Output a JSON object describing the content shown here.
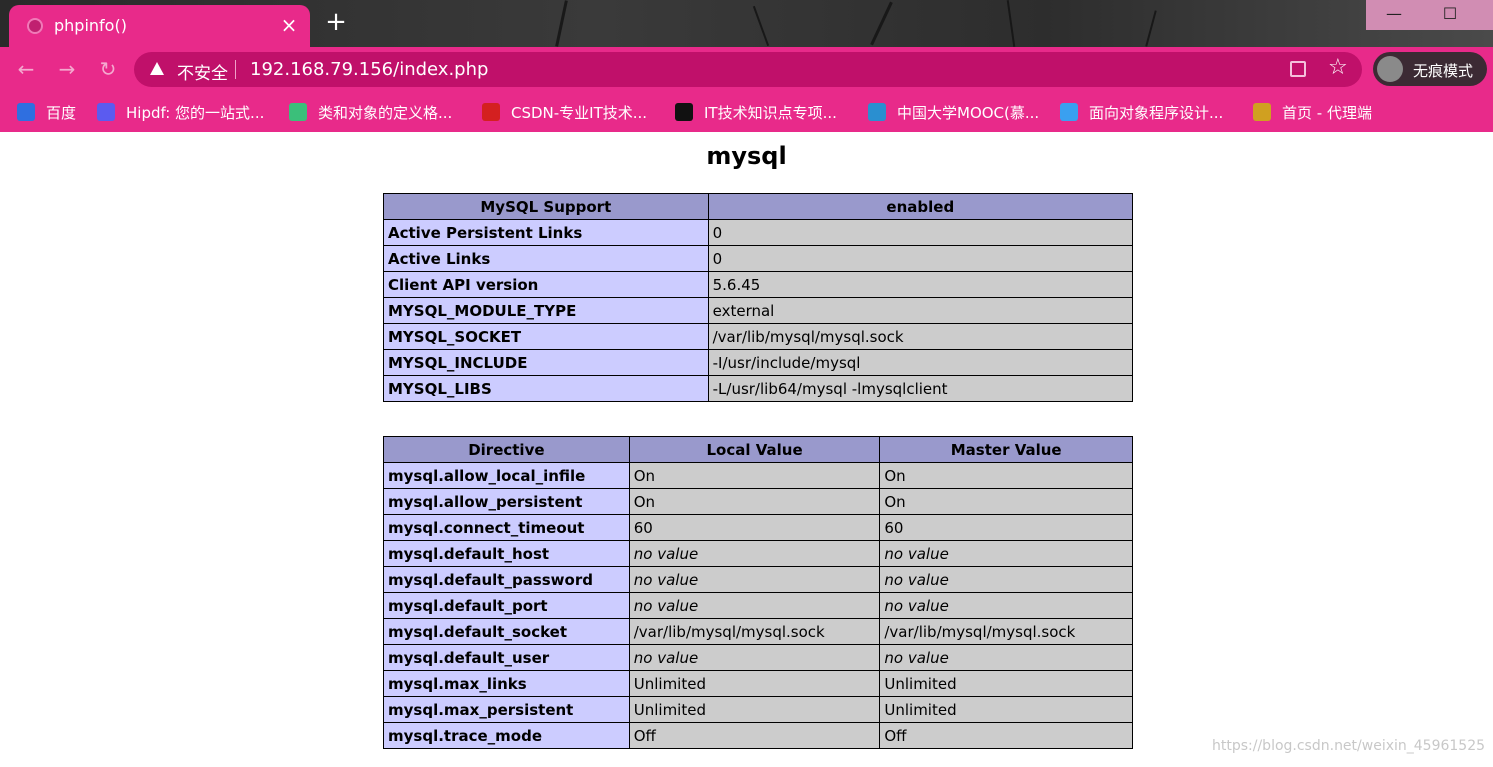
{
  "browser": {
    "tab_title": "phpinfo()",
    "tab_close": "×",
    "new_tab": "+",
    "insecure_label": "不安全",
    "url": "192.168.79.156/index.php",
    "incognito_label": "无痕模式",
    "window_min": "—",
    "window_max": "☐",
    "bookmarks": [
      {
        "label": "百度",
        "color": "#2f6fe0"
      },
      {
        "label": "Hipdf: 您的一站式...",
        "color": "#5b5bf0"
      },
      {
        "label": "类和对象的定义格...",
        "color": "#3bbf7a"
      },
      {
        "label": "CSDN-专业IT技术...",
        "color": "#d42020"
      },
      {
        "label": "IT技术知识点专项...",
        "color": "#111111"
      },
      {
        "label": "中国大学MOOC(慕...",
        "color": "#2a8fd0"
      },
      {
        "label": "面向对象程序设计...",
        "color": "#3aa0f0"
      },
      {
        "label": "首页 - 代理端",
        "color": "#d0a020"
      }
    ]
  },
  "page": {
    "heading": "mysql",
    "support_table": {
      "header": [
        "MySQL Support",
        "enabled"
      ],
      "rows": [
        [
          "Active Persistent Links",
          "0"
        ],
        [
          "Active Links",
          "0"
        ],
        [
          "Client API version",
          "5.6.45"
        ],
        [
          "MYSQL_MODULE_TYPE",
          "external"
        ],
        [
          "MYSQL_SOCKET",
          "/var/lib/mysql/mysql.sock"
        ],
        [
          "MYSQL_INCLUDE",
          "-I/usr/include/mysql"
        ],
        [
          "MYSQL_LIBS",
          "-L/usr/lib64/mysql -lmysqlclient"
        ]
      ]
    },
    "directive_table": {
      "header": [
        "Directive",
        "Local Value",
        "Master Value"
      ],
      "rows": [
        [
          "mysql.allow_local_infile",
          "On",
          "On"
        ],
        [
          "mysql.allow_persistent",
          "On",
          "On"
        ],
        [
          "mysql.connect_timeout",
          "60",
          "60"
        ],
        [
          "mysql.default_host",
          "no value",
          "no value"
        ],
        [
          "mysql.default_password",
          "no value",
          "no value"
        ],
        [
          "mysql.default_port",
          "no value",
          "no value"
        ],
        [
          "mysql.default_socket",
          "/var/lib/mysql/mysql.sock",
          "/var/lib/mysql/mysql.sock"
        ],
        [
          "mysql.default_user",
          "no value",
          "no value"
        ],
        [
          "mysql.max_links",
          "Unlimited",
          "Unlimited"
        ],
        [
          "mysql.max_persistent",
          "Unlimited",
          "Unlimited"
        ],
        [
          "mysql.trace_mode",
          "Off",
          "Off"
        ]
      ]
    },
    "watermark": "https://blog.csdn.net/weixin_45961525"
  }
}
